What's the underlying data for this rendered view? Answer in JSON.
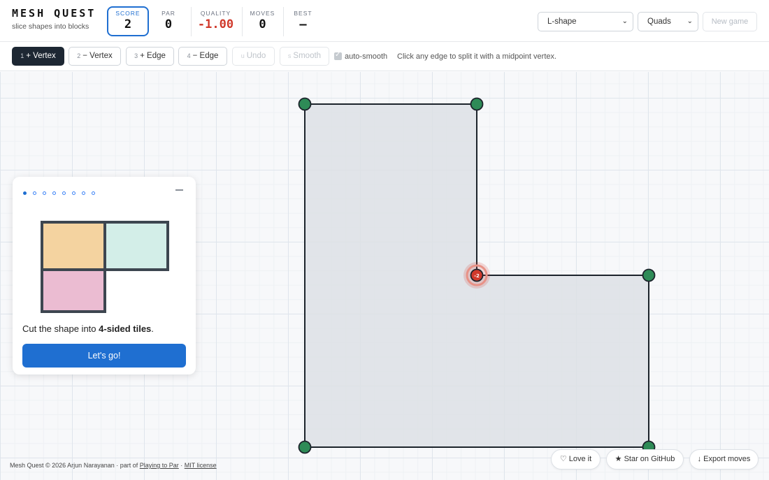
{
  "brand": {
    "title": "MESH QUEST",
    "subtitle": "slice shapes into blocks"
  },
  "stats": {
    "score": {
      "label": "SCORE",
      "value": "2"
    },
    "par": {
      "label": "PAR",
      "value": "0"
    },
    "quality": {
      "label": "QUALITY",
      "value": "-1.00",
      "color": "#d0392b"
    },
    "moves": {
      "label": "MOVES",
      "value": "0"
    },
    "best": {
      "label": "BEST",
      "value": "–"
    }
  },
  "controls": {
    "shape_select": "L-shape",
    "mode_select": "Quads",
    "new_game": "New game"
  },
  "toolbar": {
    "tools": [
      {
        "key": "1",
        "label": "+ Vertex",
        "active": true
      },
      {
        "key": "2",
        "label": "− Vertex"
      },
      {
        "key": "3",
        "label": "+ Edge"
      },
      {
        "key": "4",
        "label": "− Edge"
      },
      {
        "key": "u",
        "label": "Undo",
        "disabled": true
      },
      {
        "key": "s",
        "label": "Smooth",
        "disabled": true
      }
    ],
    "auto_smooth_label": "auto-smooth",
    "auto_smooth_checked": true,
    "hint": "Click any edge to split it with a midpoint vertex."
  },
  "mesh": {
    "shape": "L-shape",
    "vertices": [
      {
        "id": "v0",
        "state": "ok"
      },
      {
        "id": "v1",
        "state": "ok"
      },
      {
        "id": "v2",
        "state": "bad",
        "badge": "-2"
      },
      {
        "id": "v3",
        "state": "ok"
      },
      {
        "id": "v4",
        "state": "ok"
      },
      {
        "id": "v5",
        "state": "ok"
      }
    ],
    "fill_color": "#dde1e5",
    "edge_color": "#1c232b",
    "vertex_ok_color": "#2e8b57",
    "vertex_bad_color": "#d0392b"
  },
  "tutorial": {
    "step_count": 8,
    "current_step": 1,
    "text_prefix": "Cut the shape into ",
    "text_bold": "4-sided tiles",
    "text_suffix": ".",
    "button": "Let's go!",
    "tile_colors": [
      "#f4d3a0",
      "#d3eee8",
      "#ebbcd2"
    ]
  },
  "footer": {
    "text": "Mesh Quest © 2026 Arjun Narayanan · part of ",
    "link1": "Playing to Par",
    "separator": " · ",
    "link2": "MIT license"
  },
  "actions": {
    "love": "♡ Love it",
    "star": "★ Star on GitHub",
    "export": "↓ Export moves"
  },
  "colors": {
    "accent": "#1f6fd1",
    "dark_button": "#1d2733",
    "error": "#d0392b"
  }
}
